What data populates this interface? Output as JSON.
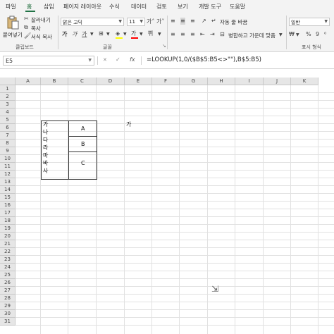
{
  "ribbon_tabs": [
    "파일",
    "홈",
    "삽입",
    "페이지 레이아웃",
    "수식",
    "데이터",
    "검토",
    "보기",
    "개발 도구",
    "도움말"
  ],
  "active_tab": "홈",
  "clipboard": {
    "paste": "붙여넣기",
    "cut": "잘라내기",
    "copy": "복사",
    "format_painter": "서식 복사",
    "group_label": "클립보드"
  },
  "font": {
    "name": "맑은 고딕",
    "size": "11",
    "grow": "가˄",
    "shrink": "가˅",
    "bold": "가",
    "italic": "가",
    "underline": "가",
    "font_color_glyph": "가",
    "group_label": "글꼴"
  },
  "alignment": {
    "wrap_text": "자동 줄 바꿈",
    "merge_center": "병합하고 가운데 맞춤"
  },
  "number": {
    "format": "일반",
    "group_label": "표시 형식"
  },
  "formula_bar": {
    "name_box": "E5",
    "cancel": "✕",
    "enter": "✓",
    "fx": "fx",
    "formula": "=LOOKUP(1,0/($B$5:B5<>\"\"),B$5:B5)"
  },
  "columns": [
    "A",
    "B",
    "C",
    "D",
    "E",
    "F",
    "G",
    "H",
    "I",
    "J",
    "K"
  ],
  "rows": [
    "1",
    "2",
    "3",
    "4",
    "5",
    "6",
    "7",
    "8",
    "9",
    "10",
    "11",
    "12",
    "13",
    "14",
    "15",
    "16",
    "17",
    "18",
    "19",
    "20",
    "21",
    "22",
    "23",
    "24",
    "25",
    "26",
    "27",
    "28",
    "29",
    "30",
    "31"
  ],
  "cells": {
    "B5": "가",
    "B6": "나",
    "B7": "다",
    "B8": "라",
    "B9": "마",
    "B10": "바",
    "B11": "사",
    "C5": "A",
    "C7": "B",
    "C9": "C",
    "E5": "가"
  },
  "colors": {
    "accent": "#217346",
    "header_bg": "#e6e6e6",
    "ribbon_bg": "#f3f3f3"
  }
}
